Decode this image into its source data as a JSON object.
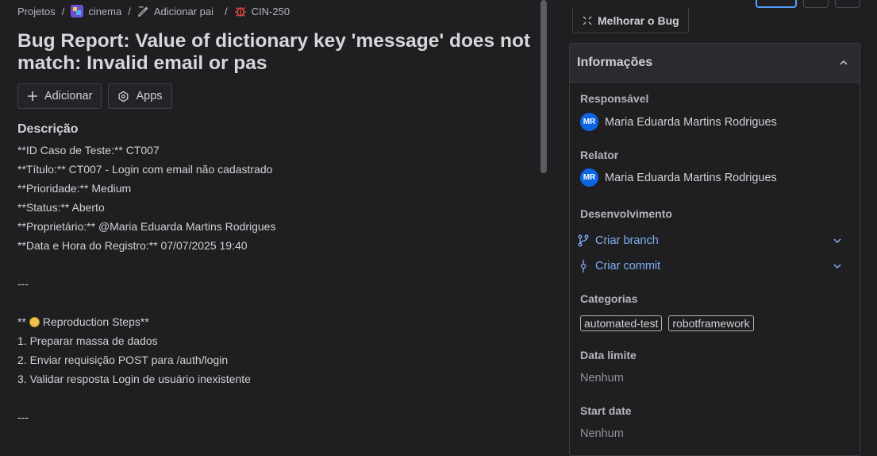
{
  "breadcrumb": {
    "projects": "Projetos",
    "project": "cinema",
    "add_parent": "Adicionar pai",
    "issue_key": "CIN-250"
  },
  "issue": {
    "title": "Bug Report: Value of dictionary key 'message' does not match: Invalid email or pas"
  },
  "actions": {
    "add": "Adicionar",
    "apps": "Apps"
  },
  "description": {
    "heading": "Descrição",
    "lines": [
      "**ID Caso de Teste:** CT007",
      "**Título:** CT007 - Login com email não cadastrado",
      "**Prioridade:** Medium",
      "**Status:** Aberto",
      "**Proprietário:** @Maria Eduarda Martins Rodrigues",
      "**Data e Hora do Registro:** 07/07/2025 19:40",
      "",
      "---",
      "",
      "Reproduction Steps**",
      "1. Preparar massa de dados",
      "2. Enviar requisição POST para /auth/login",
      "3. Validar resposta Login de usuário inexistente",
      "",
      "---"
    ],
    "steps_prefix": "**"
  },
  "sidebar": {
    "improve_bug": "Melhorar o Bug",
    "panel_title": "Informações",
    "assignee_label": "Responsável",
    "assignee_initials": "MR",
    "assignee_name": "Maria Eduarda Martins Rodrigues",
    "reporter_label": "Relator",
    "reporter_initials": "MR",
    "reporter_name": "Maria Eduarda Martins Rodrigues",
    "development_label": "Desenvolvimento",
    "create_branch": "Criar branch",
    "create_commit": "Criar commit",
    "categories_label": "Categorias",
    "categories": [
      "automated-test",
      "robotframework"
    ],
    "due_date_label": "Data limite",
    "due_date_value": "Nenhum",
    "start_date_label": "Start date",
    "start_date_value": "Nenhum"
  },
  "colors": {
    "background": "#1f1f21",
    "accent_link": "#7fb0f5",
    "avatar": "#0c66e4",
    "bug_icon": "#e5483d"
  }
}
